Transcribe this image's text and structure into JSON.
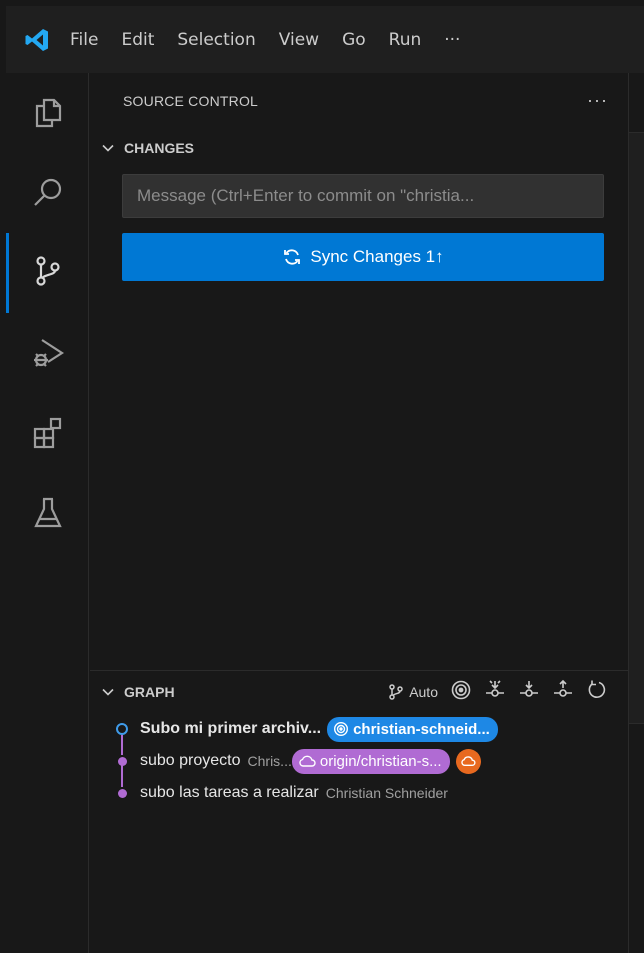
{
  "menu": {
    "items": [
      "File",
      "Edit",
      "Selection",
      "View",
      "Go",
      "Run",
      "···"
    ]
  },
  "activity_bar": {
    "icons": [
      "explorer-icon",
      "search-icon",
      "source-control-icon",
      "run-debug-icon",
      "extensions-icon",
      "testing-icon"
    ]
  },
  "sidebar": {
    "title": "SOURCE CONTROL",
    "more": "···",
    "changes_title": "CHANGES",
    "commit_placeholder": "Message (Ctrl+Enter to commit on \"christia...",
    "sync_label": "Sync Changes 1↑"
  },
  "graph": {
    "title": "GRAPH",
    "auto_label": "Auto",
    "rows": [
      {
        "subject": "Subo mi primer archiv...",
        "author": "",
        "badge": "christian-schneid..."
      },
      {
        "subject": "subo proyecto",
        "author": "Chris...",
        "badge": "origin/christian-s..."
      },
      {
        "subject": "subo las tareas a realizar",
        "author": "Christian Schneider",
        "badge": ""
      }
    ]
  },
  "colors": {
    "accent": "#0078d4",
    "local_branch": "#1e88e5",
    "remote_branch": "#b06bd3",
    "remote_icon": "#e8691f"
  }
}
